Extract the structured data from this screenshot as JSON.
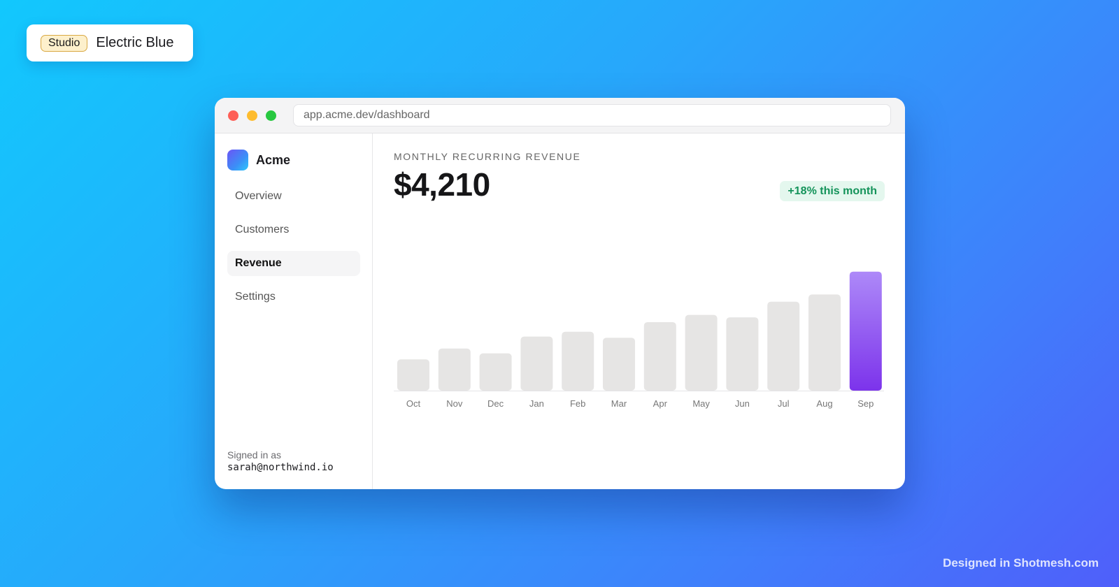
{
  "studio": {
    "badge": "Studio",
    "theme_name": "Electric Blue"
  },
  "browser": {
    "url": "app.acme.dev/dashboard"
  },
  "sidebar": {
    "brand": "Acme",
    "items": [
      {
        "label": "Overview",
        "active": false
      },
      {
        "label": "Customers",
        "active": false
      },
      {
        "label": "Revenue",
        "active": true
      },
      {
        "label": "Settings",
        "active": false
      }
    ],
    "signed_in_label": "Signed in as",
    "signed_in_email": "sarah@northwind.io"
  },
  "metric": {
    "label": "MONTHLY RECURRING REVENUE",
    "value": "$4,210",
    "change": "+18% this month"
  },
  "chart_data": {
    "type": "bar",
    "categories": [
      "Oct",
      "Nov",
      "Dec",
      "Jan",
      "Feb",
      "Mar",
      "Apr",
      "May",
      "Jun",
      "Jul",
      "Aug",
      "Sep"
    ],
    "values": [
      26,
      35,
      31,
      45,
      49,
      44,
      57,
      63,
      61,
      74,
      80,
      99
    ],
    "highlight_index": 11,
    "bar_color": "#e6e5e4",
    "highlight_gradient": [
      "#ad89f8",
      "#7c33eb"
    ],
    "ylim": [
      0,
      100
    ],
    "grid": false,
    "legend": "none",
    "title": "",
    "xlabel": "",
    "ylabel": ""
  },
  "footer": {
    "credit": "Designed in Shotmesh.com"
  }
}
